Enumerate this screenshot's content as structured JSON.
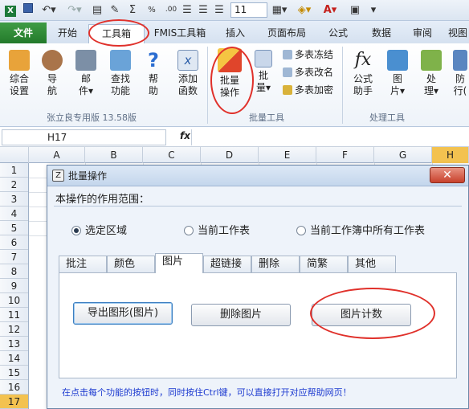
{
  "qat": {
    "font_size": "11"
  },
  "tabs": {
    "file": "文件",
    "items": [
      "开始",
      "工具箱",
      "FMIS工具箱",
      "插入",
      "页面布局",
      "公式",
      "数据",
      "审阅",
      "视图"
    ]
  },
  "ribbon": {
    "group1": {
      "label": "张立良专用版 13.58版",
      "buttons": [
        {
          "line1": "综合",
          "line2": "设置"
        },
        {
          "line1": "导",
          "line2": "航"
        },
        {
          "line1": "邮",
          "line2": "件▾"
        },
        {
          "line1": "查找",
          "line2": "功能"
        },
        {
          "line1": "帮",
          "line2": "助"
        },
        {
          "line1": "添加",
          "line2": "函数"
        }
      ]
    },
    "group2": {
      "label": "批量工具",
      "big_button": {
        "line1": "批量",
        "line2": "操作"
      },
      "button2": {
        "line1": "批",
        "line2": "量▾"
      },
      "small": [
        "多表冻结",
        "多表改名",
        "多表加密"
      ]
    },
    "group3": {
      "label": "处理工具",
      "buttons": [
        {
          "line1": "公式",
          "line2": "助手"
        },
        {
          "line1": "图",
          "line2": "片▾"
        },
        {
          "line1": "处",
          "line2": "理▾"
        },
        {
          "line1": "防",
          "line2": "行("
        }
      ]
    }
  },
  "formula_bar": {
    "cell_ref": "H17",
    "fx": "fx"
  },
  "grid": {
    "columns": [
      "A",
      "B",
      "C",
      "D",
      "E",
      "F",
      "G",
      "H"
    ],
    "rows": [
      "1",
      "2",
      "3",
      "4",
      "5",
      "6",
      "7",
      "8",
      "9",
      "10",
      "11",
      "12",
      "13",
      "14",
      "15",
      "16",
      "17"
    ]
  },
  "dialog": {
    "title": "批量操作",
    "close": "✕",
    "scope_label": "本操作的作用范围：",
    "radios": [
      {
        "label": "选定区域",
        "checked": true
      },
      {
        "label": "当前工作表",
        "checked": false
      },
      {
        "label": "当前工作簿中所有工作表",
        "checked": false
      }
    ],
    "tabs": [
      "批注",
      "颜色",
      "图片",
      "超链接",
      "删除",
      "简繁",
      "其他"
    ],
    "active_tab": "图片",
    "buttons": {
      "export": "导出图形(图片)",
      "delete": "删除图片",
      "count": "图片计数"
    },
    "hint": "在点击每个功能的按钮时，同时按住Ctrl键，可以直接打开对应帮助网页！"
  }
}
